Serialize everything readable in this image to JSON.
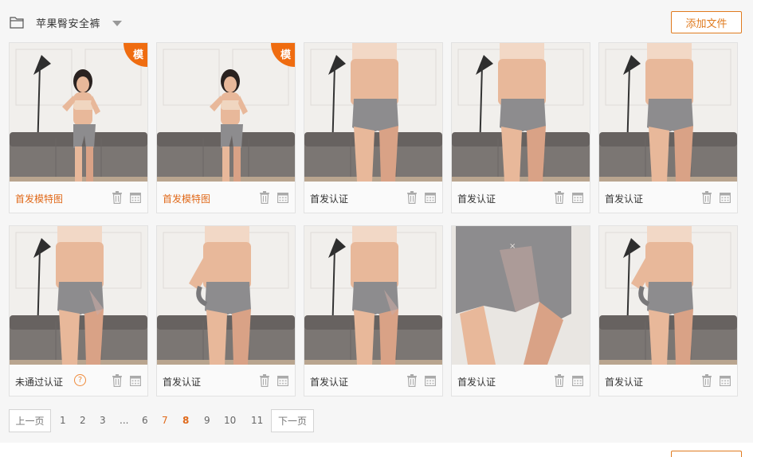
{
  "header": {
    "folder_title": "苹果臀安全裤",
    "add_file_label": "添加文件"
  },
  "colors": {
    "accent": "#e07b1f",
    "badge": "#ef6c10",
    "current_page": "#e0691a"
  },
  "cards": [
    {
      "label": "首发模特图",
      "badge": "模",
      "status_color": "orange"
    },
    {
      "label": "首发模特图",
      "badge": "模",
      "status_color": "orange"
    },
    {
      "label": "首发认证",
      "badge": "",
      "status_color": "default"
    },
    {
      "label": "首发认证",
      "badge": "",
      "status_color": "default"
    },
    {
      "label": "首发认证",
      "badge": "",
      "status_color": "default"
    },
    {
      "label": "未通过认证",
      "badge": "",
      "status_color": "default",
      "help": "?"
    },
    {
      "label": "首发认证",
      "badge": "",
      "status_color": "default"
    },
    {
      "label": "首发认证",
      "badge": "",
      "status_color": "default"
    },
    {
      "label": "首发认证",
      "badge": "",
      "status_color": "default"
    },
    {
      "label": "首发认证",
      "badge": "",
      "status_color": "default"
    }
  ],
  "pagination": {
    "prev_label": "上一页",
    "next_label": "下一页",
    "pages": [
      "1",
      "2",
      "3",
      "...",
      "6",
      "7",
      "8",
      "9",
      "10",
      "11"
    ],
    "current": "8"
  },
  "icons": {
    "folder": "folder-icon",
    "caret": "caret-down-icon",
    "trash": "trash-icon",
    "calendar": "calendar-icon",
    "help": "help-icon"
  }
}
